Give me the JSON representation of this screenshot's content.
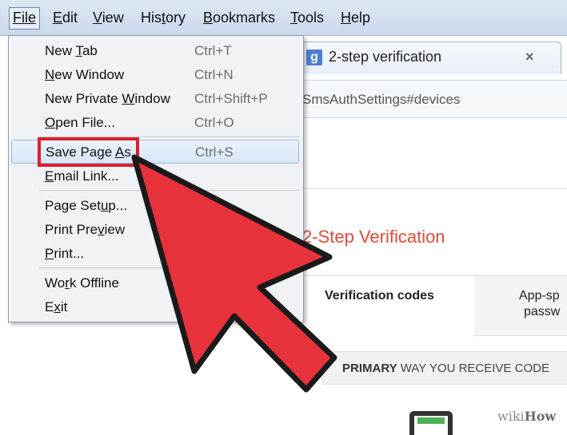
{
  "menubar": {
    "file": "File",
    "edit": "Edit",
    "view": "View",
    "history": "History",
    "bookmarks": "Bookmarks",
    "tools": "Tools",
    "help": "Help"
  },
  "browser": {
    "tab_favicon": "g",
    "tab_title": "2-step verification",
    "tab_close": "×",
    "address": "SmsAuthSettings#devices"
  },
  "page": {
    "heading": "2-Step Verification",
    "tab_codes": "Verification codes",
    "tab_app_line1": "App-sp",
    "tab_app_line2": "passw",
    "primary_bold": "PRIMARY",
    "primary_rest": " WAY YOU RECEIVE CODE"
  },
  "file_menu": {
    "new_tab": {
      "label": "New Tab",
      "shortcut": "Ctrl+T"
    },
    "new_window": {
      "label": "New Window",
      "shortcut": "Ctrl+N"
    },
    "new_private_window": {
      "label": "New Private Window",
      "shortcut": "Ctrl+Shift+P"
    },
    "open_file": {
      "label": "Open File...",
      "shortcut": "Ctrl+O"
    },
    "save_page_as": {
      "label": "Save Page As.",
      "shortcut": "Ctrl+S"
    },
    "email_link": {
      "label": "Email Link..."
    },
    "page_setup": {
      "label": "Page Setup..."
    },
    "print_preview": {
      "label": "Print Preview"
    },
    "print": {
      "label": "Print..."
    },
    "work_offline": {
      "label": "Work Offline"
    },
    "exit": {
      "label": "Exit"
    }
  },
  "watermark": {
    "prefix": "wiki",
    "suffix": "How"
  },
  "colors": {
    "arrow": "#e8323c",
    "highlight_box": "#d9202f",
    "heading": "#dd4b39"
  }
}
